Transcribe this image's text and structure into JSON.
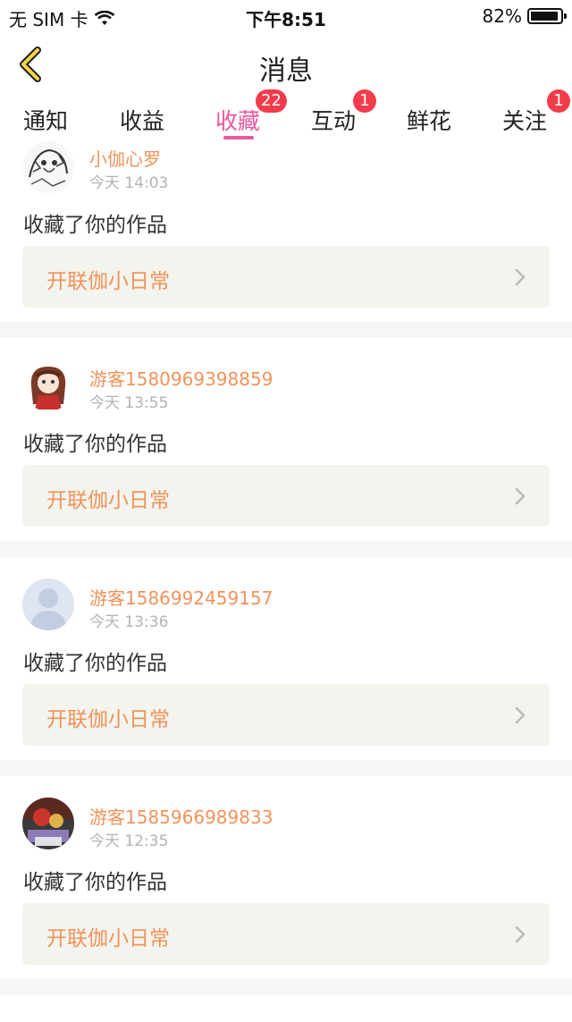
{
  "status_bar": {
    "carrier": "无 SIM 卡",
    "time": "下午8:51",
    "battery": "82%"
  },
  "nav": {
    "title": "消息"
  },
  "tabs": [
    {
      "label": "通知",
      "badge": ""
    },
    {
      "label": "收益",
      "badge": ""
    },
    {
      "label": "收藏",
      "badge": "22"
    },
    {
      "label": "互动",
      "badge": "1"
    },
    {
      "label": "鲜花",
      "badge": ""
    },
    {
      "label": "关注",
      "badge": "1"
    }
  ],
  "notifications": [
    {
      "username": "小伽心罗",
      "time": "今天 14:03",
      "action": "收藏了你的作品",
      "work_title": "开联伽小日常"
    },
    {
      "username": "游客1580969398859",
      "time": "今天 13:55",
      "action": "收藏了你的作品",
      "work_title": "开联伽小日常"
    },
    {
      "username": "游客1586992459157",
      "time": "今天 13:36",
      "action": "收藏了你的作品",
      "work_title": "开联伽小日常"
    },
    {
      "username": "游客1585966989833",
      "time": "今天 12:35",
      "action": "收藏了你的作品",
      "work_title": "开联伽小日常"
    }
  ],
  "colors": {
    "accent": "#e857a0",
    "badge": "#f23c4b",
    "username": "#f0935b"
  }
}
